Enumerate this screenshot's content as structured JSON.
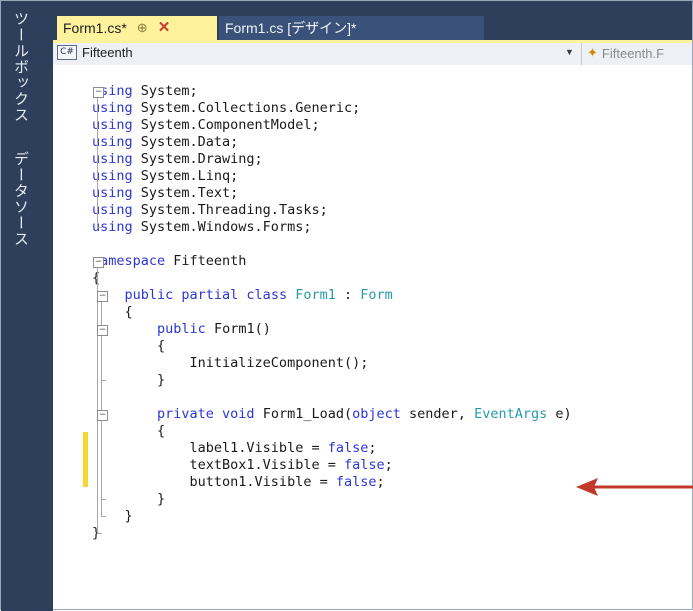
{
  "sidebar": {
    "toolbox_label": "ツールボックス",
    "datasource_label": "データソース"
  },
  "tabs": [
    {
      "label": "Form1.cs*",
      "pin": "⊕",
      "close": "✕"
    },
    {
      "label": "Form1.cs [デザイン]*"
    }
  ],
  "navbar": {
    "left_icon": "C#",
    "left_label": "Fifteenth",
    "right_label": "Fifteenth.F"
  },
  "code": [
    [
      [
        "kw",
        "using"
      ],
      [
        "t",
        " System;"
      ]
    ],
    [
      [
        "kw",
        "using"
      ],
      [
        "t",
        " System.Collections.Generic;"
      ]
    ],
    [
      [
        "kw",
        "using"
      ],
      [
        "t",
        " System.ComponentModel;"
      ]
    ],
    [
      [
        "kw",
        "using"
      ],
      [
        "t",
        " System.Data;"
      ]
    ],
    [
      [
        "kw",
        "using"
      ],
      [
        "t",
        " System.Drawing;"
      ]
    ],
    [
      [
        "kw",
        "using"
      ],
      [
        "t",
        " System.Linq;"
      ]
    ],
    [
      [
        "kw",
        "using"
      ],
      [
        "t",
        " System.Text;"
      ]
    ],
    [
      [
        "kw",
        "using"
      ],
      [
        "t",
        " System.Threading.Tasks;"
      ]
    ],
    [
      [
        "kw",
        "using"
      ],
      [
        "t",
        " System.Windows.Forms;"
      ]
    ],
    [],
    [
      [
        "kw",
        "namespace"
      ],
      [
        "t",
        " Fifteenth"
      ]
    ],
    [
      [
        "t",
        "{"
      ]
    ],
    [
      [
        "t",
        "    "
      ],
      [
        "kw",
        "public partial class"
      ],
      [
        "t",
        " "
      ],
      [
        "ty",
        "Form1"
      ],
      [
        "t",
        " : "
      ],
      [
        "ty",
        "Form"
      ]
    ],
    [
      [
        "t",
        "    {"
      ]
    ],
    [
      [
        "t",
        "        "
      ],
      [
        "kw",
        "public"
      ],
      [
        "t",
        " Form1()"
      ]
    ],
    [
      [
        "t",
        "        {"
      ]
    ],
    [
      [
        "t",
        "            InitializeComponent();"
      ]
    ],
    [
      [
        "t",
        "        }"
      ]
    ],
    [],
    [
      [
        "t",
        "        "
      ],
      [
        "kw",
        "private void"
      ],
      [
        "t",
        " Form1_Load("
      ],
      [
        "kw",
        "object"
      ],
      [
        "t",
        " sender, "
      ],
      [
        "ty",
        "EventArgs"
      ],
      [
        "t",
        " e)"
      ]
    ],
    [
      [
        "t",
        "        {"
      ]
    ],
    [
      [
        "t",
        "            label1.Visible = "
      ],
      [
        "kw",
        "false"
      ],
      [
        "t",
        ";"
      ]
    ],
    [
      [
        "t",
        "            textBox1.Visible = "
      ],
      [
        "kw",
        "false"
      ],
      [
        "t",
        ";"
      ]
    ],
    [
      [
        "t",
        "            button1.Visible = "
      ],
      [
        "kw",
        "false"
      ],
      [
        "t",
        ";"
      ]
    ],
    [
      [
        "t",
        "        }"
      ]
    ],
    [
      [
        "t",
        "    }"
      ]
    ],
    [
      [
        "t",
        "}"
      ]
    ]
  ],
  "colors": {
    "keyword": "#2b36d6",
    "type": "#2a9aaa",
    "active_tab": "#fff29d",
    "change_marker": "#f5d72e",
    "annotation_arrow": "#c0392b"
  }
}
